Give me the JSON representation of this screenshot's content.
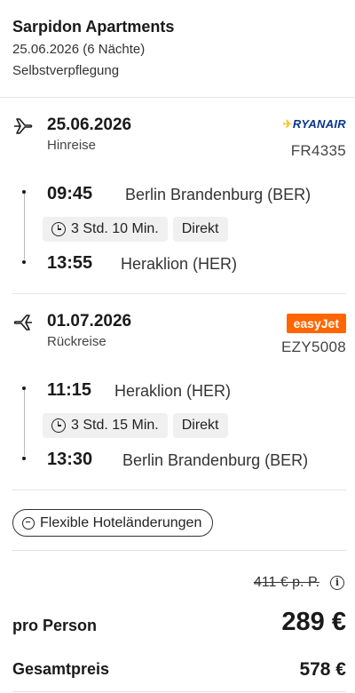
{
  "hotel": {
    "name": "Sarpidon Apartments",
    "dates": "25.06.2026 (6 Nächte)",
    "board": "Selbstverpflegung"
  },
  "outbound": {
    "icon": "plane-departure-icon",
    "date": "25.06.2026",
    "type": "Hinreise",
    "airline": "RYANAIR",
    "flight_no": "FR4335",
    "dep_time": "09:45",
    "dep_airport": "Berlin Brandenburg (BER)",
    "duration": "3 Std. 10 Min.",
    "stops": "Direkt",
    "arr_time": "13:55",
    "arr_airport": "Heraklion (HER)"
  },
  "inbound": {
    "icon": "plane-arrival-icon",
    "date": "01.07.2026",
    "type": "Rückreise",
    "airline": "easyJet",
    "flight_no": "EZY5008",
    "dep_time": "11:15",
    "dep_airport": "Heraklion (HER)",
    "duration": "3 Std. 15 Min.",
    "stops": "Direkt",
    "arr_time": "13:30",
    "arr_airport": "Berlin Brandenburg (BER)"
  },
  "flex": {
    "label": "Flexible Hoteländerungen"
  },
  "price": {
    "old": "411 € p. P.",
    "per_person_label": "pro Person",
    "per_person": "289 €",
    "total_label": "Gesamtpreis",
    "total": "578 €"
  },
  "colors": {
    "ryanair_blue": "#073590",
    "easyjet_orange": "#ff6600"
  }
}
